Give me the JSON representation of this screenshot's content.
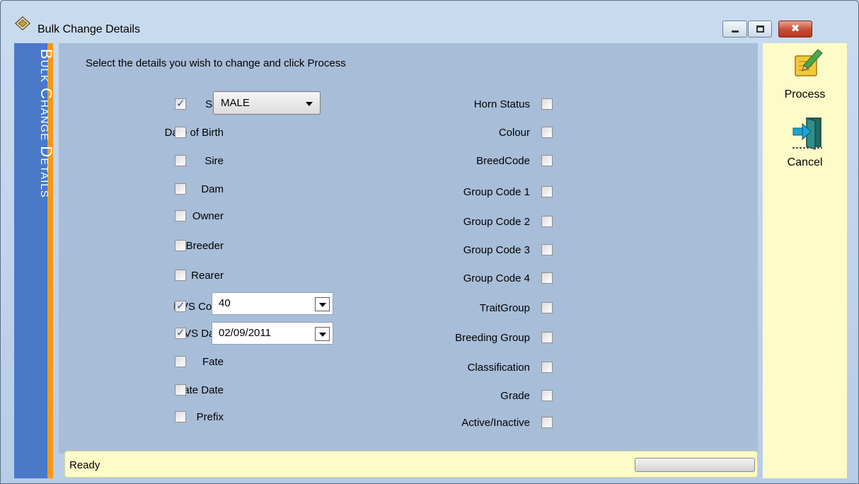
{
  "window": {
    "title": "Bulk Change Details",
    "icon": "shield-diamond-icon",
    "controls": {
      "minimize": "minimize-icon",
      "maximize": "maximize-icon",
      "close": "✖"
    }
  },
  "side_banner": {
    "text": "Bulk Change Details"
  },
  "main": {
    "instruction": "Select the details you wish to change and click Process",
    "left_fields": [
      {
        "label": "Sex",
        "checked": true
      },
      {
        "label": "Date of Birth",
        "checked": false
      },
      {
        "label": "Sire",
        "checked": false
      },
      {
        "label": "Dam",
        "checked": false
      },
      {
        "label": "Owner",
        "checked": false
      },
      {
        "label": "Breeder",
        "checked": false
      },
      {
        "label": "Rearer",
        "checked": false
      },
      {
        "label": "DVS Code",
        "checked": true
      },
      {
        "label": "DVS Date",
        "checked": true
      },
      {
        "label": "Fate",
        "checked": false
      },
      {
        "label": "Fate Date",
        "checked": false
      },
      {
        "label": "Prefix",
        "checked": false
      }
    ],
    "right_fields": [
      {
        "label": "Horn Status",
        "checked": false
      },
      {
        "label": "Colour",
        "checked": false
      },
      {
        "label": "BreedCode",
        "checked": false
      },
      {
        "label": "Group Code 1",
        "checked": false
      },
      {
        "label": "Group Code 2",
        "checked": false
      },
      {
        "label": "Group Code 3",
        "checked": false
      },
      {
        "label": "Group Code 4",
        "checked": false
      },
      {
        "label": "TraitGroup",
        "checked": false
      },
      {
        "label": "Breeding Group",
        "checked": false
      },
      {
        "label": "Classification",
        "checked": false
      },
      {
        "label": "Grade",
        "checked": false
      },
      {
        "label": "Active/Inactive",
        "checked": false
      }
    ],
    "sex_value": "MALE",
    "dvs_code_value": "40",
    "dvs_date_value": "02/09/2011"
  },
  "status": {
    "text": "Ready",
    "progress": 0
  },
  "actions": {
    "process_label": "Process",
    "process_icon": "notepad-pencil-icon",
    "cancel_label": "Cancel",
    "cancel_icon": "exit-door-icon"
  }
}
